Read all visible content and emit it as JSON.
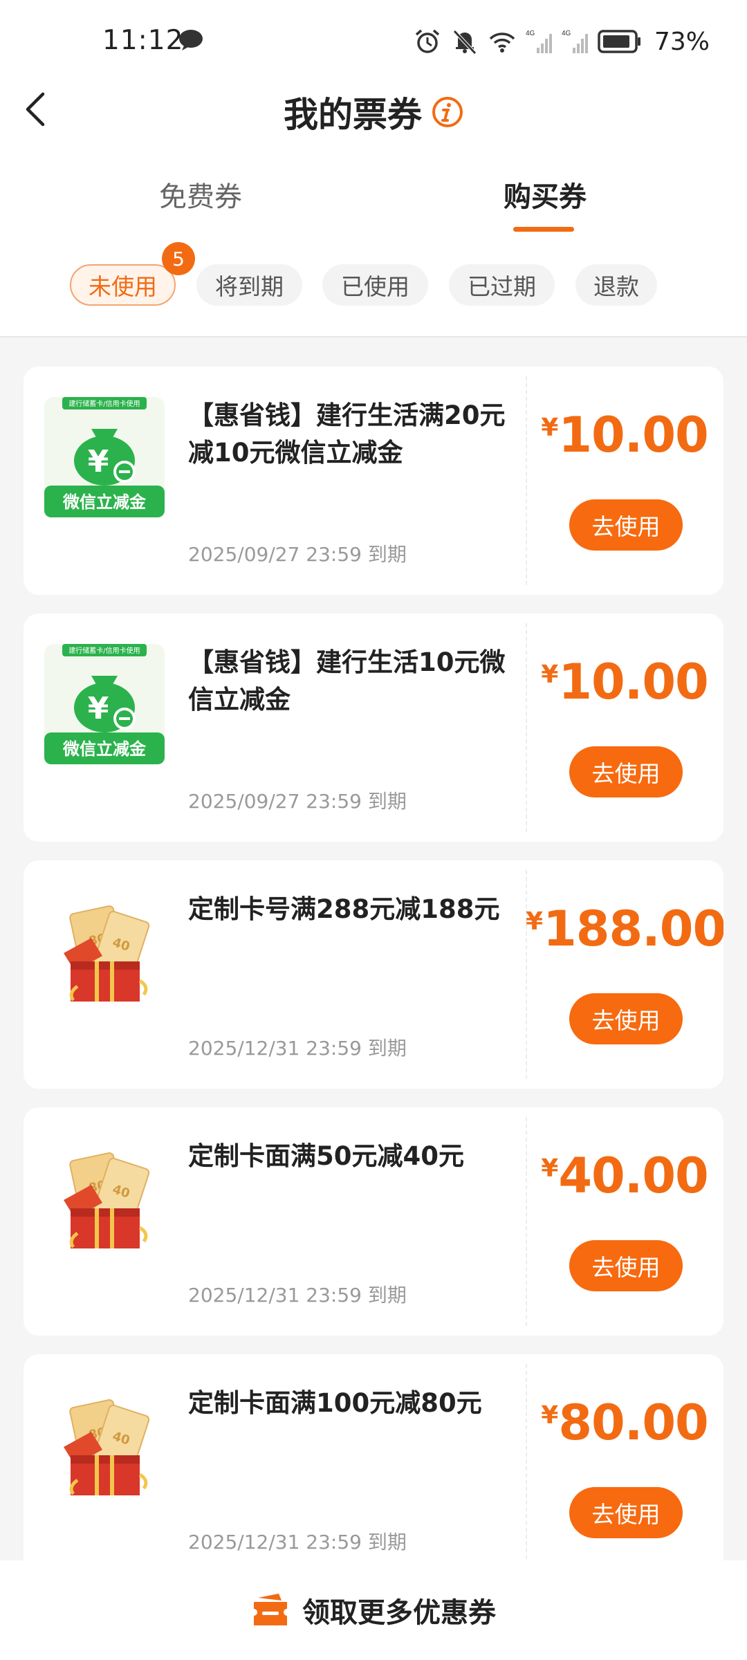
{
  "status_bar": {
    "time": "11:12",
    "battery": "73%",
    "net1": "4G",
    "net2": "4G"
  },
  "header": {
    "title": "我的票券"
  },
  "tabs": [
    {
      "label": "免费券",
      "active": false
    },
    {
      "label": "购买券",
      "active": true
    }
  ],
  "filters": [
    {
      "label": "未使用",
      "active": true,
      "badge": "5"
    },
    {
      "label": "将到期",
      "active": false
    },
    {
      "label": "已使用",
      "active": false
    },
    {
      "label": "已过期",
      "active": false
    },
    {
      "label": "退款",
      "active": false
    }
  ],
  "coupons": [
    {
      "title": "【惠省钱】建行生活满20元减10元微信立减金",
      "expiry": "2025/09/27 23:59 到期",
      "currency": "¥",
      "amount": "10.00",
      "button": "去使用",
      "icon": "wechat-money-bag-icon",
      "icon_banner": "建行储蓄卡/信用卡使用",
      "icon_label": "微信立减金"
    },
    {
      "title": "【惠省钱】建行生活10元微信立减金",
      "expiry": "2025/09/27 23:59 到期",
      "currency": "¥",
      "amount": "10.00",
      "button": "去使用",
      "icon": "wechat-money-bag-icon",
      "icon_banner": "建行储蓄卡/信用卡使用",
      "icon_label": "微信立减金"
    },
    {
      "title": "定制卡号满288元减188元",
      "expiry": "2025/12/31 23:59 到期",
      "currency": "¥",
      "amount": "188.00",
      "button": "去使用",
      "icon": "gift-box-icon"
    },
    {
      "title": "定制卡面满50元减40元",
      "expiry": "2025/12/31 23:59 到期",
      "currency": "¥",
      "amount": "40.00",
      "button": "去使用",
      "icon": "gift-box-icon"
    },
    {
      "title": "定制卡面满100元减80元",
      "expiry": "2025/12/31 23:59 到期",
      "currency": "¥",
      "amount": "80.00",
      "button": "去使用",
      "icon": "gift-box-icon"
    }
  ],
  "bottom_bar": {
    "label": "领取更多优惠券",
    "icon": "coupon-ticket-icon"
  },
  "colors": {
    "accent": "#f26b13",
    "button": "#f76a0f",
    "wechat_green": "#2bb24c"
  }
}
